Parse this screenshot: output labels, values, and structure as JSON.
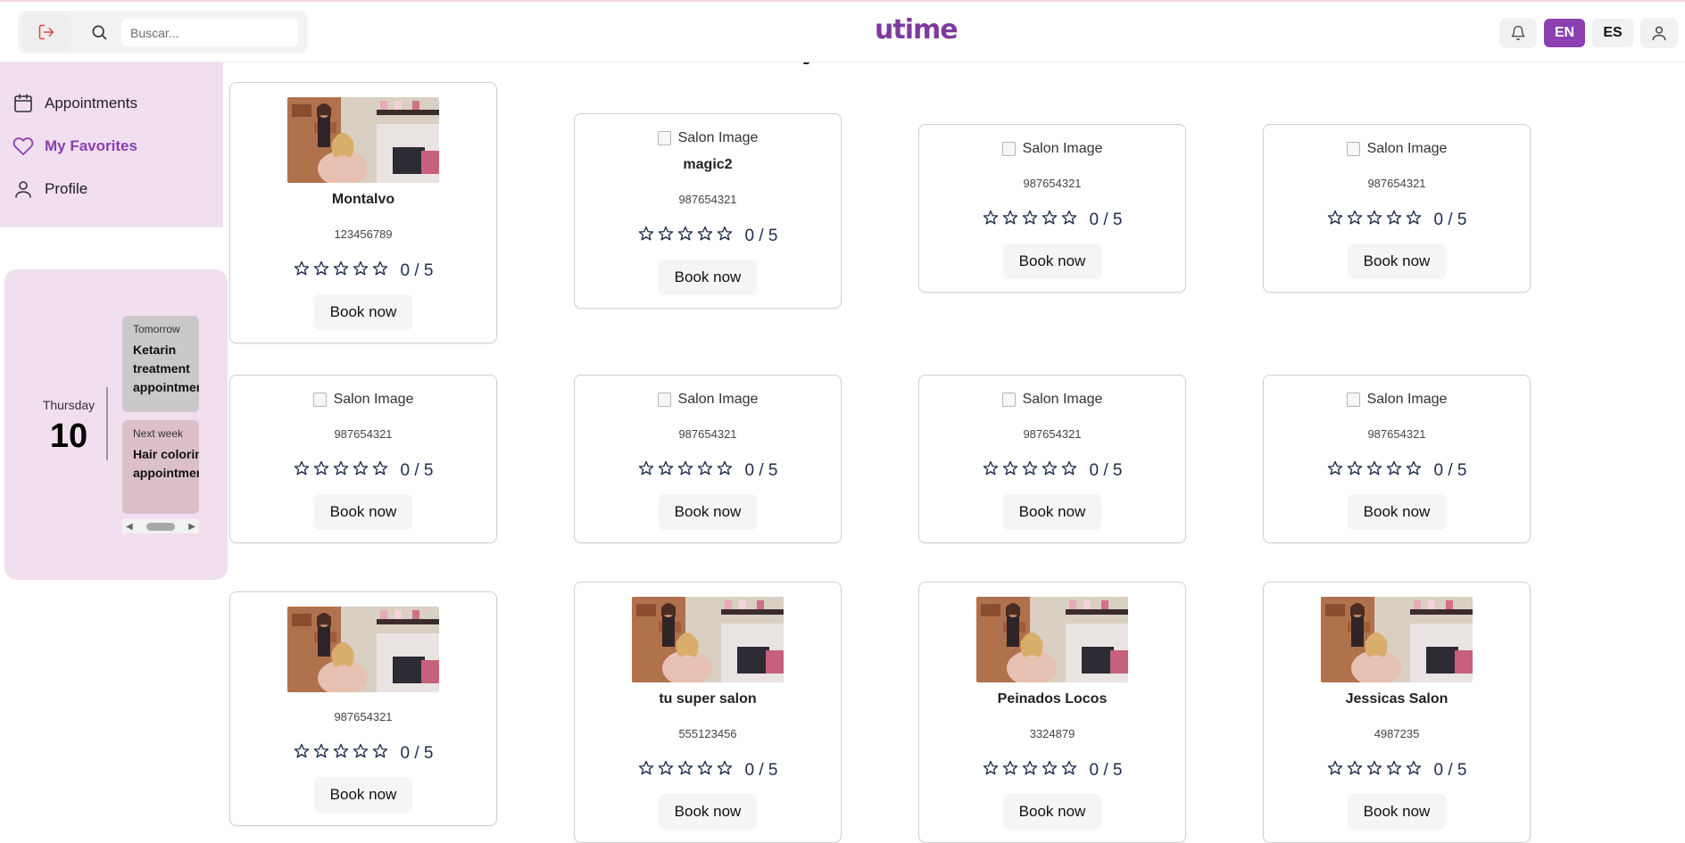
{
  "header": {
    "search_placeholder": "Buscar...",
    "logo": "utime",
    "lang_en": "EN",
    "lang_es": "ES"
  },
  "sidebar": {
    "items": [
      {
        "label": "Appointments",
        "icon": "calendar-icon"
      },
      {
        "label": "My Favorites",
        "icon": "heart-icon",
        "active": true
      },
      {
        "label": "Profile",
        "icon": "user-icon"
      }
    ]
  },
  "calendar": {
    "weekday": "Thursday",
    "day": "10",
    "events": [
      {
        "when": "Tomorrow",
        "what": "Ketarin treatment appointment"
      },
      {
        "when": "Next week",
        "what": "Hair coloring appointment"
      }
    ]
  },
  "main": {
    "heading_fragment": "y",
    "image_alt": "Salon Image",
    "book_label": "Book now",
    "cards": [
      {
        "name": "Montalvo",
        "phone": "123456789",
        "rating": "0 / 5",
        "has_image": true
      },
      {
        "name": "magic2",
        "phone": "987654321",
        "rating": "0 / 5",
        "has_image": false
      },
      {
        "name": "",
        "phone": "987654321",
        "rating": "0 / 5",
        "has_image": false
      },
      {
        "name": "",
        "phone": "987654321",
        "rating": "0 / 5",
        "has_image": false
      },
      {
        "name": "",
        "phone": "987654321",
        "rating": "0 / 5",
        "has_image": false
      },
      {
        "name": "",
        "phone": "987654321",
        "rating": "0 / 5",
        "has_image": false
      },
      {
        "name": "",
        "phone": "987654321",
        "rating": "0 / 5",
        "has_image": false
      },
      {
        "name": "",
        "phone": "987654321",
        "rating": "0 / 5",
        "has_image": false
      },
      {
        "name": "",
        "phone": "987654321",
        "rating": "0 / 5",
        "has_image": true
      },
      {
        "name": "tu super salon",
        "phone": "555123456",
        "rating": "0 / 5",
        "has_image": true
      },
      {
        "name": "Peinados Locos",
        "phone": "3324879",
        "rating": "0 / 5",
        "has_image": true
      },
      {
        "name": "Jessicas Salon",
        "phone": "4987235",
        "rating": "0 / 5",
        "has_image": true
      }
    ]
  },
  "colors": {
    "brand": "#8b3fb0",
    "sidebar_bg": "#f1deef"
  }
}
